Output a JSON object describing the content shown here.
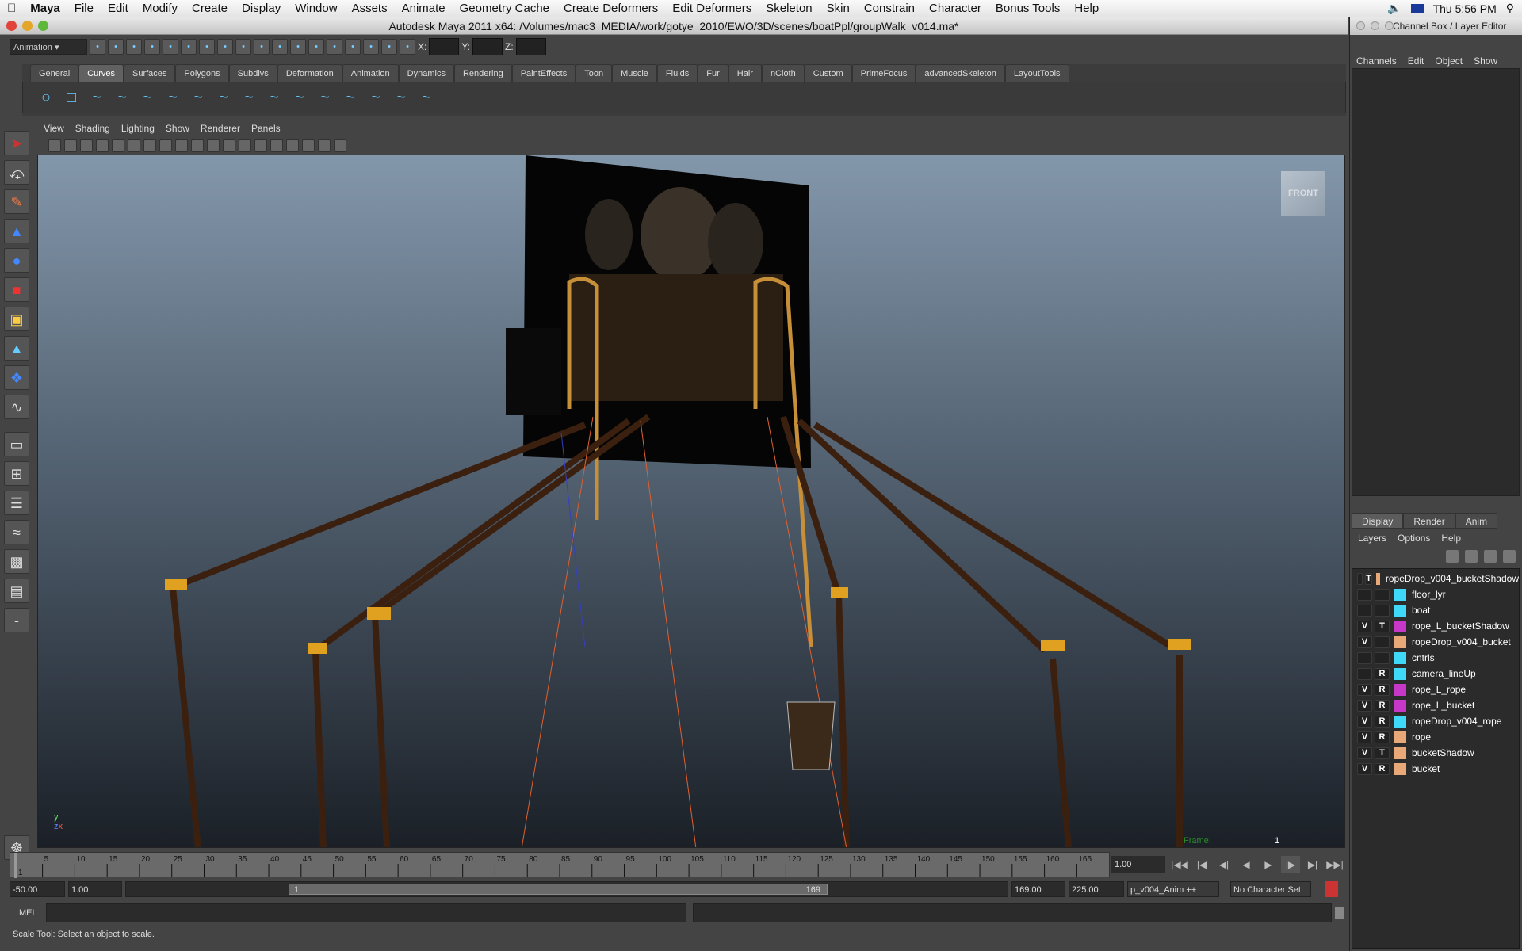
{
  "menubar": {
    "app": "Maya",
    "items": [
      "File",
      "Edit",
      "Modify",
      "Create",
      "Display",
      "Window",
      "Assets",
      "Animate",
      "Geometry Cache",
      "Create Deformers",
      "Edit Deformers",
      "Skeleton",
      "Skin",
      "Constrain",
      "Character",
      "Bonus Tools",
      "Help"
    ],
    "clock": "Thu 5:56 PM"
  },
  "window": {
    "title": "Autodesk Maya 2011 x64: /Volumes/mac3_MEDIA/work/gotye_2010/EWO/3D/scenes/boatPpl/groupWalk_v014.ma*"
  },
  "toolbar": {
    "mode": "Animation",
    "x_label": "X:",
    "y_label": "Y:",
    "z_label": "Z:"
  },
  "shelf": {
    "tabs": [
      "General",
      "Curves",
      "Surfaces",
      "Polygons",
      "Subdivs",
      "Deformation",
      "Animation",
      "Dynamics",
      "Rendering",
      "PaintEffects",
      "Toon",
      "Muscle",
      "Fluids",
      "Fur",
      "Hair",
      "nCloth",
      "Custom",
      "PrimeFocus",
      "advancedSkeleton",
      "LayoutTools"
    ],
    "active": "Curves"
  },
  "viewport": {
    "menus": [
      "View",
      "Shading",
      "Lighting",
      "Show",
      "Renderer",
      "Panels"
    ],
    "cube_label": "FRONT",
    "frame_label": "Frame:",
    "frame_value": "1",
    "axis_y": "y",
    "axis_z": "z",
    "axis_x": "x"
  },
  "channelbox": {
    "title": "Channel Box / Layer Editor",
    "menus": [
      "Channels",
      "Edit",
      "Object",
      "Show"
    ]
  },
  "layers": {
    "tabs": [
      "Display",
      "Render",
      "Anim"
    ],
    "active": "Display",
    "menus": [
      "Layers",
      "Options",
      "Help"
    ],
    "rows": [
      {
        "v": "",
        "t": "T",
        "color": "#e8a878",
        "name": "ropeDrop_v004_bucketShadow"
      },
      {
        "v": "",
        "t": "",
        "color": "#40d8f8",
        "name": "floor_lyr"
      },
      {
        "v": "",
        "t": "",
        "color": "#40d8f8",
        "name": "boat"
      },
      {
        "v": "V",
        "t": "T",
        "color": "#c838c8",
        "name": "rope_L_bucketShadow"
      },
      {
        "v": "V",
        "t": "",
        "color": "#e8a878",
        "name": "ropeDrop_v004_bucket"
      },
      {
        "v": "",
        "t": "",
        "color": "#40d8f8",
        "name": "cntrls"
      },
      {
        "v": "",
        "t": "R",
        "color": "#40d8f8",
        "name": "camera_lineUp"
      },
      {
        "v": "V",
        "t": "R",
        "color": "#c838c8",
        "name": "rope_L_rope"
      },
      {
        "v": "V",
        "t": "R",
        "color": "#c838c8",
        "name": "rope_L_bucket"
      },
      {
        "v": "V",
        "t": "R",
        "color": "#40d8f8",
        "name": "ropeDrop_v004_rope"
      },
      {
        "v": "V",
        "t": "R",
        "color": "#e8a878",
        "name": "rope"
      },
      {
        "v": "V",
        "t": "T",
        "color": "#e8a878",
        "name": "bucketShadow"
      },
      {
        "v": "V",
        "t": "R",
        "color": "#e8a878",
        "name": "bucket"
      }
    ]
  },
  "timeline": {
    "start": 1,
    "end": 169,
    "ticks": [
      "1",
      "5",
      "10",
      "15",
      "20",
      "25",
      "30",
      "35",
      "40",
      "45",
      "50",
      "55",
      "60",
      "65",
      "70",
      "75",
      "80",
      "85",
      "90",
      "95",
      "100",
      "105",
      "110",
      "115",
      "120",
      "125",
      "130",
      "135",
      "140",
      "145",
      "150",
      "155",
      "160",
      "165"
    ],
    "current_time": "1.00",
    "current_frame": 1
  },
  "range": {
    "anim_start": "-50.00",
    "playback_start": "1.00",
    "slider_start": "1",
    "slider_end": "169",
    "playback_end": "169.00",
    "anim_end": "225.00",
    "anim_layer": "p_v004_Anim ++",
    "character_set": "No Character Set"
  },
  "mel": {
    "label": "MEL"
  },
  "help_line": "Scale Tool: Select an object to scale."
}
